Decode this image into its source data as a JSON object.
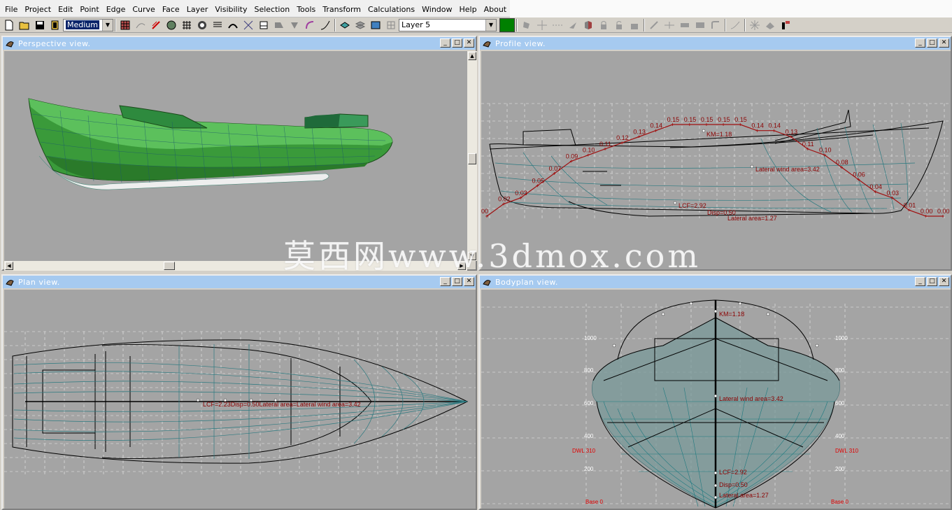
{
  "menu": [
    "File",
    "Project",
    "Edit",
    "Point",
    "Edge",
    "Curve",
    "Face",
    "Layer",
    "Visibility",
    "Selection",
    "Tools",
    "Transform",
    "Calculations",
    "Window",
    "Help",
    "About"
  ],
  "toolbar": {
    "precision_value": "Medium",
    "layer_value": "Layer 5",
    "layer_color": "#008000"
  },
  "views": {
    "perspective": {
      "title": "Perspective view."
    },
    "profile": {
      "title": "Profile view."
    },
    "plan": {
      "title": "Plan view."
    },
    "bodyplan": {
      "title": "Bodyplan view."
    }
  },
  "window_buttons": {
    "minimize": "_",
    "maximize": "□",
    "close": "✕"
  },
  "profile_labels": {
    "km": "KM=1.18",
    "lcf": "LCF=2.92",
    "disp": "Disp=0.50",
    "lateral_area": "Lateral area=1.27",
    "lateral_wind": "Lateral wind area=3.42",
    "curve_values": [
      "00",
      "0.02",
      "0.03",
      "0.05",
      "0.07",
      "0.09",
      "0.10",
      "0.11",
      "0.12",
      "0.13",
      "0.14",
      "0.15",
      "0.15",
      "0.15",
      "0.15",
      "0.15",
      "0.14",
      "0.14",
      "0.13",
      "0.11",
      "0.10",
      "0.08",
      "0.06",
      "0.04",
      "0.03",
      "0.01",
      "0.00",
      "0.00"
    ]
  },
  "plan_labels": {
    "overlap": "LCF=2.23Disp=0.50Lateral area=Lateral wind area=3.42"
  },
  "bodyplan_labels": {
    "km": "KM=1.18",
    "lateral_wind": "Lateral wind area=3.42",
    "lcf": "LCF=2.92",
    "disp": "Disp=0.50",
    "lateral_area": "Lateral area=1.27",
    "dwl_left": "DWL 310",
    "dwl_right": "DWL 310",
    "base_left": "Base 0",
    "base_right": "Base 0",
    "scale_left": [
      "1000",
      "800",
      "600",
      "400",
      "200"
    ],
    "scale_right": [
      "1000",
      "800",
      "600",
      "400",
      "200"
    ]
  },
  "watermark": "莫西网www.3dmox.com"
}
